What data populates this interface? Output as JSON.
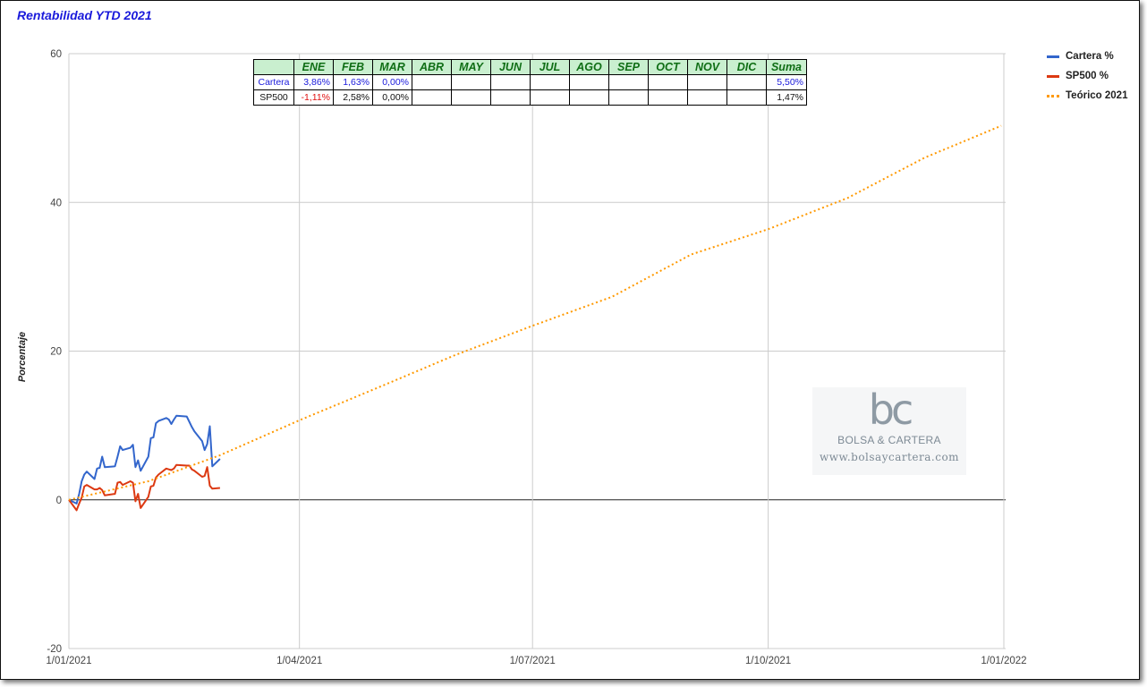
{
  "chart_data": {
    "type": "line",
    "title": "Rentabilidad YTD 2021",
    "ylabel": "Porcentaje",
    "xlabel": "",
    "ylim": [
      -20,
      60
    ],
    "yticks": [
      -20,
      0,
      20,
      40,
      60
    ],
    "xlim": [
      "2021-01-01",
      "2022-01-01"
    ],
    "xticks": [
      {
        "date": "2021-01-01",
        "label": "1/01/2021"
      },
      {
        "date": "2021-04-01",
        "label": "1/04/2021"
      },
      {
        "date": "2021-07-01",
        "label": "1/07/2021"
      },
      {
        "date": "2021-10-01",
        "label": "1/10/2021"
      },
      {
        "date": "2022-01-01",
        "label": "1/01/2022"
      }
    ],
    "grid": true,
    "legend_position": "right",
    "series": [
      {
        "name": "Cartera %",
        "color": "#3366cc",
        "style": "solid",
        "points": [
          [
            "2021-01-01",
            0.0
          ],
          [
            "2021-01-04",
            -0.5
          ],
          [
            "2021-01-05",
            0.8
          ],
          [
            "2021-01-06",
            2.5
          ],
          [
            "2021-01-07",
            3.4
          ],
          [
            "2021-01-08",
            3.8
          ],
          [
            "2021-01-11",
            2.8
          ],
          [
            "2021-01-12",
            4.2
          ],
          [
            "2021-01-13",
            4.3
          ],
          [
            "2021-01-14",
            5.8
          ],
          [
            "2021-01-15",
            4.4
          ],
          [
            "2021-01-19",
            4.5
          ],
          [
            "2021-01-20",
            5.8
          ],
          [
            "2021-01-21",
            7.2
          ],
          [
            "2021-01-22",
            6.7
          ],
          [
            "2021-01-25",
            7.0
          ],
          [
            "2021-01-26",
            7.4
          ],
          [
            "2021-01-27",
            4.4
          ],
          [
            "2021-01-28",
            5.3
          ],
          [
            "2021-01-29",
            3.9
          ],
          [
            "2021-02-01",
            5.8
          ],
          [
            "2021-02-02",
            8.3
          ],
          [
            "2021-02-03",
            8.4
          ],
          [
            "2021-02-04",
            10.3
          ],
          [
            "2021-02-05",
            10.6
          ],
          [
            "2021-02-08",
            11.0
          ],
          [
            "2021-02-09",
            10.8
          ],
          [
            "2021-02-10",
            10.2
          ],
          [
            "2021-02-11",
            10.8
          ],
          [
            "2021-02-12",
            11.3
          ],
          [
            "2021-02-16",
            11.2
          ],
          [
            "2021-02-17",
            10.5
          ],
          [
            "2021-02-18",
            9.8
          ],
          [
            "2021-02-19",
            9.2
          ],
          [
            "2021-02-22",
            7.9
          ],
          [
            "2021-02-23",
            6.7
          ],
          [
            "2021-02-24",
            7.5
          ],
          [
            "2021-02-25",
            9.9
          ],
          [
            "2021-02-26",
            4.5
          ],
          [
            "2021-03-01",
            5.5
          ]
        ]
      },
      {
        "name": "SP500 %",
        "color": "#dc3912",
        "style": "solid",
        "points": [
          [
            "2021-01-01",
            0.0
          ],
          [
            "2021-01-04",
            -1.4
          ],
          [
            "2021-01-05",
            -0.5
          ],
          [
            "2021-01-06",
            0.3
          ],
          [
            "2021-01-07",
            1.8
          ],
          [
            "2021-01-08",
            2.0
          ],
          [
            "2021-01-11",
            1.4
          ],
          [
            "2021-01-12",
            1.4
          ],
          [
            "2021-01-13",
            1.6
          ],
          [
            "2021-01-14",
            1.3
          ],
          [
            "2021-01-15",
            0.6
          ],
          [
            "2021-01-19",
            0.8
          ],
          [
            "2021-01-20",
            2.3
          ],
          [
            "2021-01-21",
            2.4
          ],
          [
            "2021-01-22",
            2.0
          ],
          [
            "2021-01-25",
            2.5
          ],
          [
            "2021-01-26",
            2.3
          ],
          [
            "2021-01-27",
            -0.2
          ],
          [
            "2021-01-28",
            0.8
          ],
          [
            "2021-01-29",
            -1.1
          ],
          [
            "2021-02-01",
            0.4
          ],
          [
            "2021-02-02",
            1.8
          ],
          [
            "2021-02-03",
            1.9
          ],
          [
            "2021-02-04",
            3.0
          ],
          [
            "2021-02-05",
            3.4
          ],
          [
            "2021-02-08",
            4.2
          ],
          [
            "2021-02-09",
            4.1
          ],
          [
            "2021-02-10",
            4.0
          ],
          [
            "2021-02-11",
            4.2
          ],
          [
            "2021-02-12",
            4.7
          ],
          [
            "2021-02-16",
            4.6
          ],
          [
            "2021-02-17",
            4.6
          ],
          [
            "2021-02-18",
            4.1
          ],
          [
            "2021-02-19",
            3.9
          ],
          [
            "2021-02-22",
            3.1
          ],
          [
            "2021-02-23",
            3.2
          ],
          [
            "2021-02-24",
            4.4
          ],
          [
            "2021-02-25",
            1.9
          ],
          [
            "2021-02-26",
            1.5
          ],
          [
            "2021-03-01",
            1.6
          ]
        ]
      },
      {
        "name": "Teórico 2021",
        "color": "#ff9900",
        "style": "dotted",
        "points": [
          [
            "2021-01-01",
            0.0
          ],
          [
            "2021-02-01",
            2.5
          ],
          [
            "2021-03-01",
            6.0
          ],
          [
            "2021-04-01",
            10.7
          ],
          [
            "2021-05-01",
            15.0
          ],
          [
            "2021-06-01",
            19.5
          ],
          [
            "2021-07-01",
            23.4
          ],
          [
            "2021-08-01",
            27.3
          ],
          [
            "2021-09-01",
            33.0
          ],
          [
            "2021-10-01",
            36.4
          ],
          [
            "2021-11-01",
            40.6
          ],
          [
            "2021-12-01",
            46.0
          ],
          [
            "2021-12-31",
            50.3
          ]
        ]
      }
    ]
  },
  "table": {
    "headers": [
      "",
      "ENE",
      "FEB",
      "MAR",
      "ABR",
      "MAY",
      "JUN",
      "JUL",
      "AGO",
      "SEP",
      "OCT",
      "NOV",
      "DIC",
      "Suma"
    ],
    "rows": [
      {
        "label": "Cartera",
        "cells": [
          "3,86%",
          "1,63%",
          "0,00%",
          "",
          "",
          "",
          "",
          "",
          "",
          "",
          "",
          "",
          "5,50%"
        ]
      },
      {
        "label": "SP500",
        "cells": [
          "-1,11%",
          "2,58%",
          "0,00%",
          "",
          "",
          "",
          "",
          "",
          "",
          "",
          "",
          "",
          "1,47%"
        ]
      }
    ]
  },
  "watermark": {
    "logo": "bc",
    "name": "BOLSA & CARTERA",
    "url": "www.bolsaycartera.com"
  }
}
